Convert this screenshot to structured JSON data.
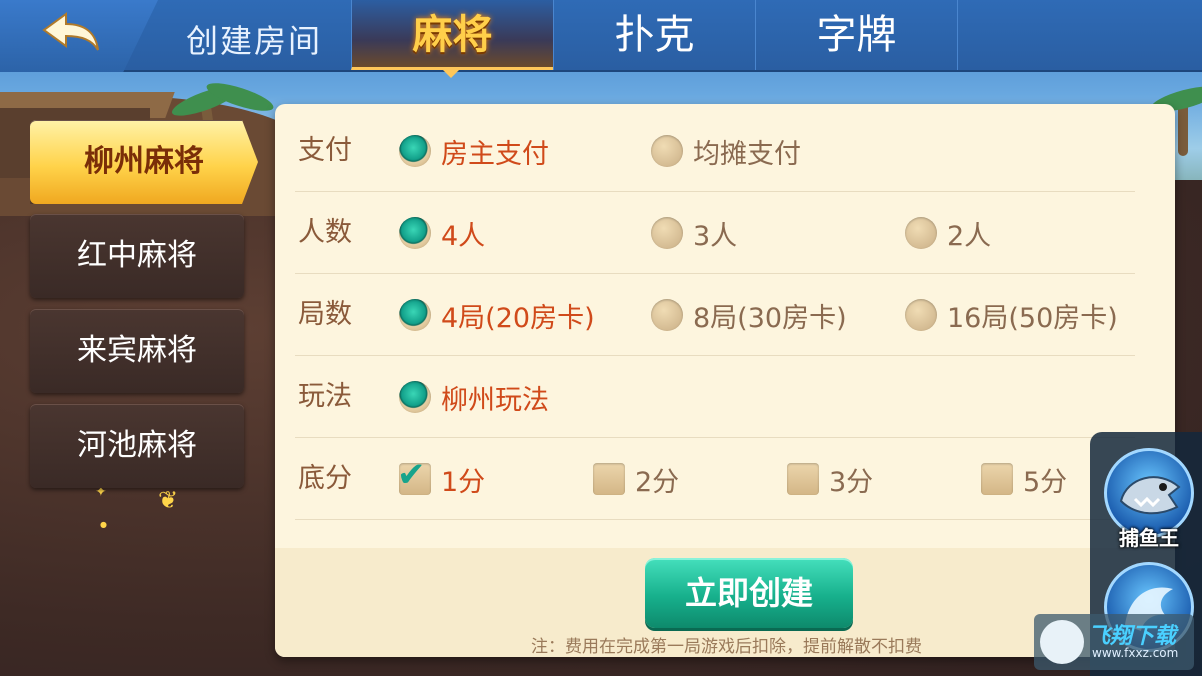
{
  "header": {
    "back_icon": "back-arrow-icon",
    "title": "创建房间",
    "tabs": [
      {
        "label": "麻将",
        "active": true
      },
      {
        "label": "扑克",
        "active": false
      },
      {
        "label": "字牌",
        "active": false
      }
    ]
  },
  "sidebar": {
    "items": [
      {
        "label": "柳州麻将",
        "active": true
      },
      {
        "label": "红中麻将",
        "active": false
      },
      {
        "label": "来宾麻将",
        "active": false
      },
      {
        "label": "河池麻将",
        "active": false
      }
    ]
  },
  "form": {
    "payment": {
      "label": "支付",
      "options": [
        "房主支付",
        "均摊支付"
      ],
      "selected": "房主支付"
    },
    "players": {
      "label": "人数",
      "options": [
        "4人",
        "3人",
        "2人"
      ],
      "selected": "4人"
    },
    "rounds": {
      "label": "局数",
      "options": [
        "4局(20房卡)",
        "8局(30房卡)",
        "16局(50房卡)"
      ],
      "selected": "4局(20房卡)"
    },
    "mode": {
      "label": "玩法",
      "options": [
        "柳州玩法"
      ],
      "selected": "柳州玩法"
    },
    "base_score": {
      "label": "底分",
      "options": [
        "1分",
        "2分",
        "3分",
        "5分"
      ],
      "checked": [
        "1分"
      ]
    }
  },
  "create_button": "立即创建",
  "note": "注：费用在完成第一局游戏后扣除，提前解散不扣费",
  "promos": [
    {
      "label": "捕鱼王",
      "icon": "shark-icon"
    },
    {
      "icon": "dragon-game-icon"
    }
  ],
  "watermark": {
    "text": "飞翔下载",
    "sub": "www.fxxz.com"
  },
  "colors": {
    "accent_teal": "#17b08c",
    "selected_text": "#d04a1a",
    "tab_active": "#ffcf4a",
    "panel_bg": "#fdf5de",
    "sidebar_active": "#ffd34a"
  }
}
